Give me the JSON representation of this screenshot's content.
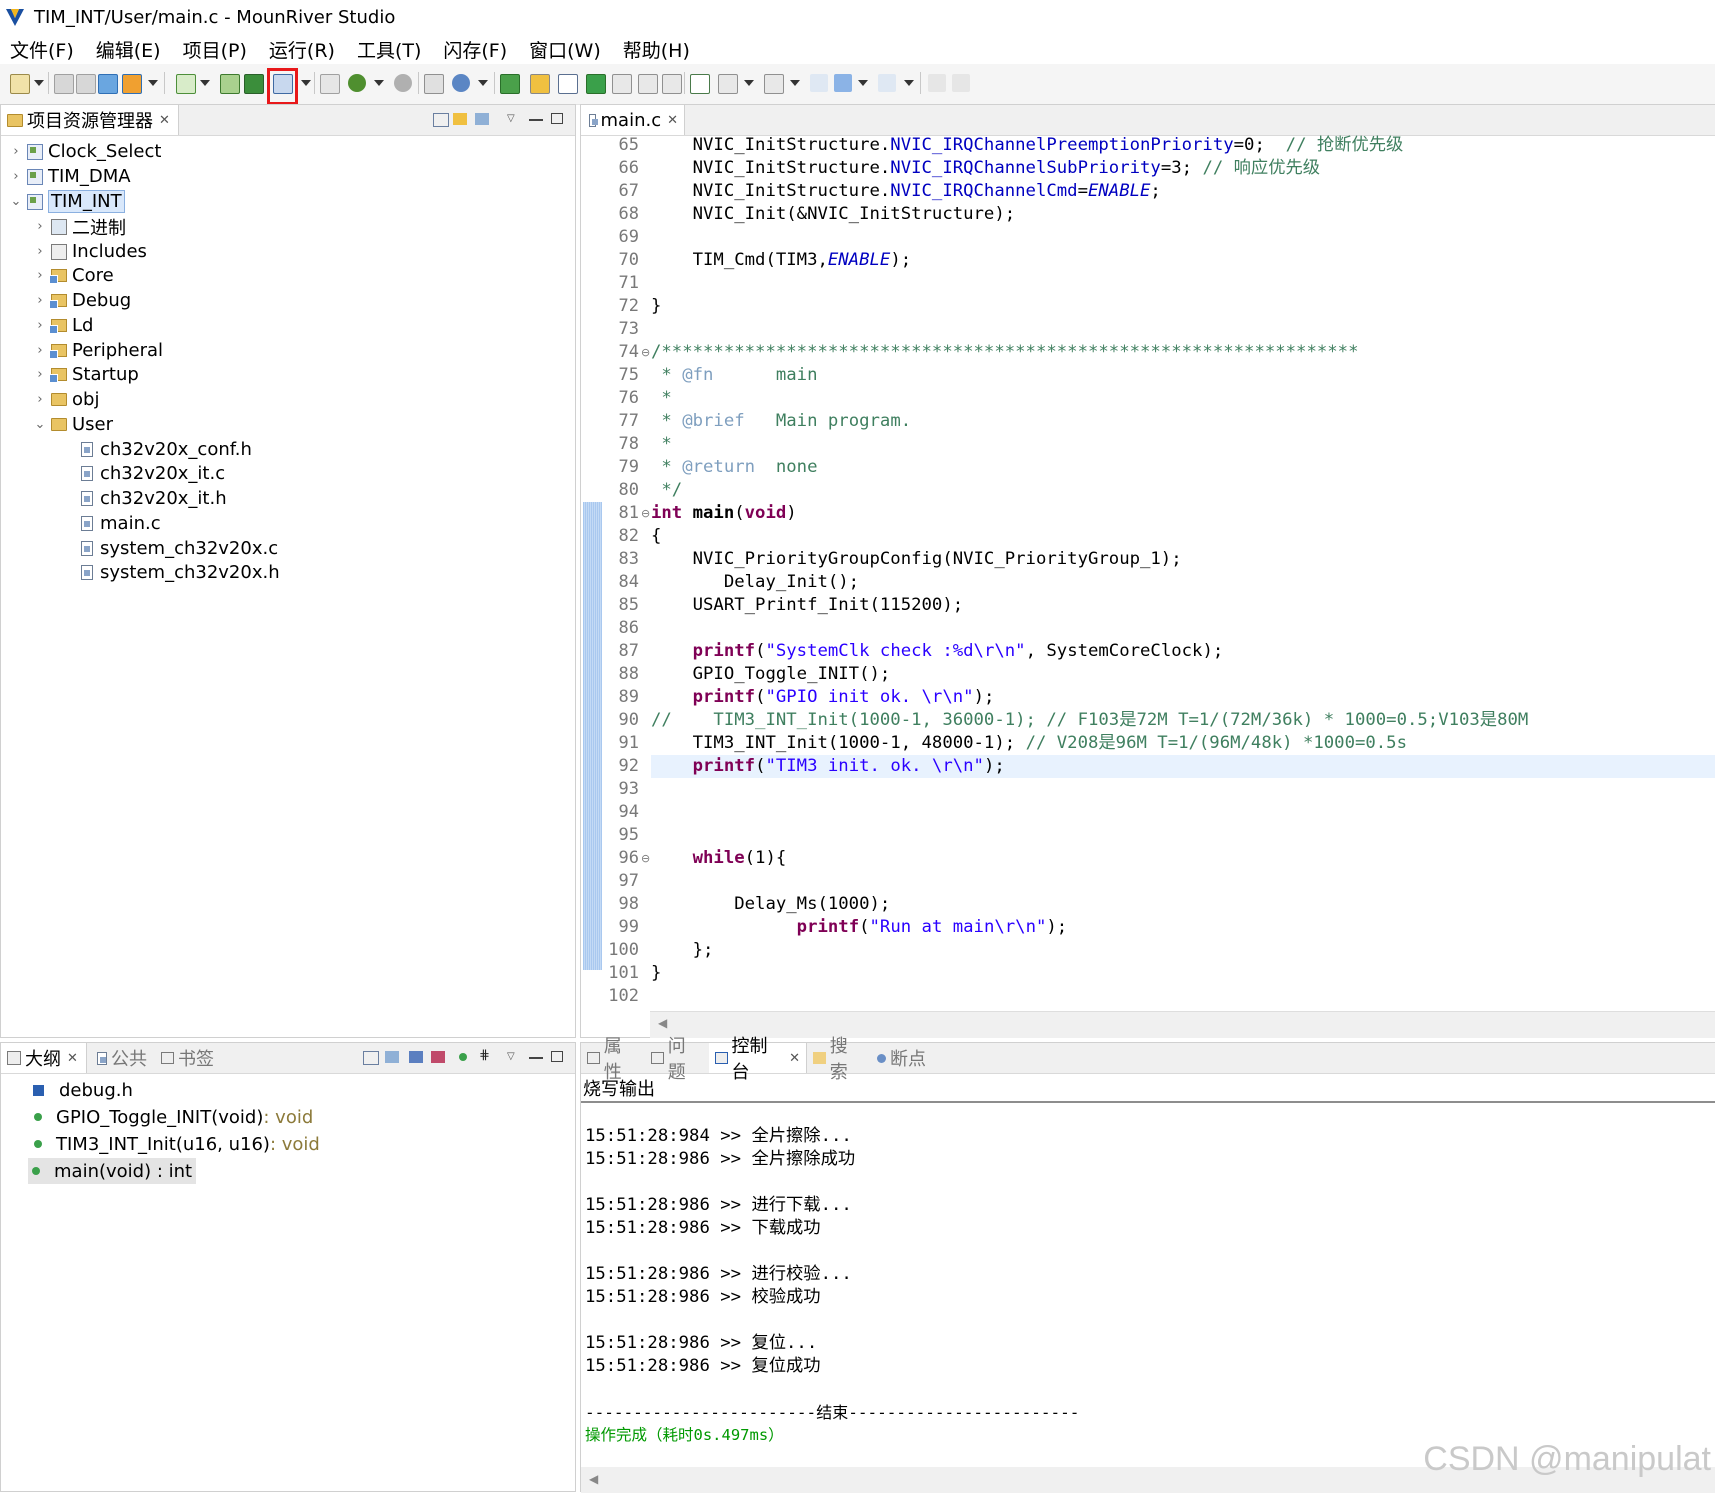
{
  "window": {
    "title": "TIM_INT/User/main.c - MounRiver Studio"
  },
  "menu": [
    "文件(F)",
    "编辑(E)",
    "项目(P)",
    "运行(R)",
    "工具(T)",
    "闪存(F)",
    "窗口(W)",
    "帮助(H)"
  ],
  "project_explorer": {
    "tab_label": "项目资源管理器",
    "items": [
      {
        "label": "Clock_Select"
      },
      {
        "label": "TIM_DMA"
      },
      {
        "label": "TIM_INT"
      },
      {
        "label": "二进制"
      },
      {
        "label": "Includes"
      },
      {
        "label": "Core"
      },
      {
        "label": "Debug"
      },
      {
        "label": "Ld"
      },
      {
        "label": "Peripheral"
      },
      {
        "label": "Startup"
      },
      {
        "label": "obj"
      },
      {
        "label": "User"
      },
      {
        "label": "ch32v20x_conf.h"
      },
      {
        "label": "ch32v20x_it.c"
      },
      {
        "label": "ch32v20x_it.h"
      },
      {
        "label": "main.c"
      },
      {
        "label": "system_ch32v20x.c"
      },
      {
        "label": "system_ch32v20x.h"
      }
    ]
  },
  "editor": {
    "tab_label": "main.c",
    "line_numbers": [
      "65",
      "66",
      "67",
      "68",
      "69",
      "70",
      "71",
      "72",
      "73",
      "74",
      "75",
      "76",
      "77",
      "78",
      "79",
      "80",
      "81",
      "82",
      "83",
      "84",
      "85",
      "86",
      "87",
      "88",
      "89",
      "90",
      "91",
      "92",
      "93",
      "94",
      "95",
      "96",
      "97",
      "98",
      "99",
      "100",
      "101",
      "102"
    ]
  },
  "outline": {
    "tabs": [
      "大纲",
      "公共",
      "书签"
    ],
    "items": [
      {
        "name": "debug.h",
        "type": ""
      },
      {
        "name": "GPIO_Toggle_INIT(void)",
        "type": " : void"
      },
      {
        "name": "TIM3_INT_Init(u16, u16)",
        "type": " : void"
      },
      {
        "name": "main(void) : int",
        "type": ""
      }
    ]
  },
  "console": {
    "tabs": [
      "属性",
      "问题",
      "控制台",
      "搜索",
      "断点"
    ],
    "title": "烧写输出",
    "lines": [
      "15:51:28:984 >> 全片擦除...",
      "15:51:28:986 >> 全片擦除成功",
      "15:51:28:986 >> 进行下载...",
      "15:51:28:986 >> 下载成功",
      "15:51:28:986 >> 进行校验...",
      "15:51:28:986 >> 校验成功",
      "15:51:28:986 >> 复位...",
      "15:51:28:986 >> 复位成功",
      "------------------------结束------------------------",
      "操作完成（耗时0s.497ms）"
    ]
  },
  "watermark": "CSDN @manipulat"
}
